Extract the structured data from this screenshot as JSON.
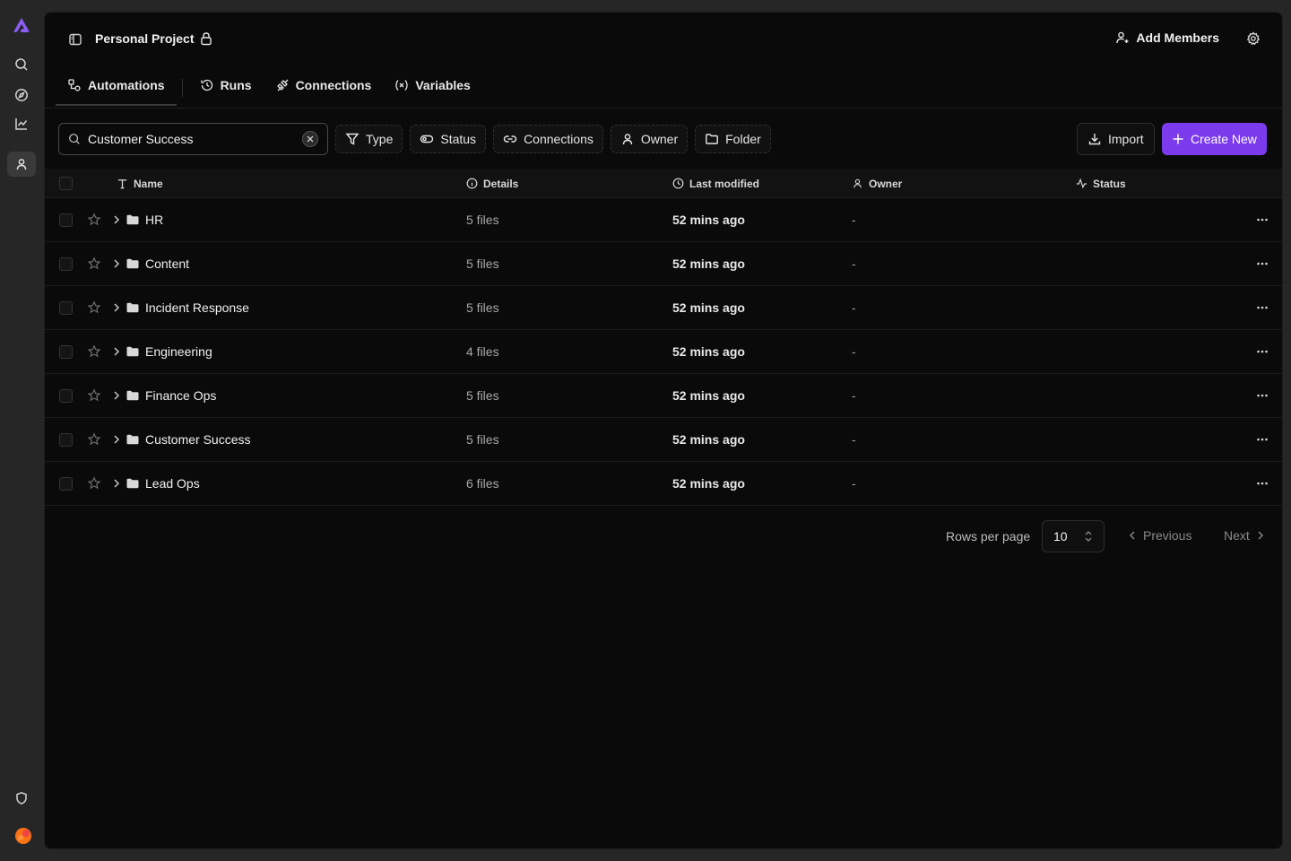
{
  "project": {
    "title": "Personal Project"
  },
  "header": {
    "add_members_label": "Add Members"
  },
  "tabs": [
    {
      "label": "Automations",
      "icon": "automations-icon",
      "active": true
    },
    {
      "label": "Runs",
      "icon": "history-icon"
    },
    {
      "label": "Connections",
      "icon": "plug-icon"
    },
    {
      "label": "Variables",
      "icon": "variable-icon"
    }
  ],
  "search": {
    "value": "Customer Success",
    "placeholder": "Search"
  },
  "filters": [
    {
      "label": "Type",
      "icon": "filter-icon"
    },
    {
      "label": "Status",
      "icon": "toggle-icon"
    },
    {
      "label": "Connections",
      "icon": "link-icon"
    },
    {
      "label": "Owner",
      "icon": "user-icon"
    },
    {
      "label": "Folder",
      "icon": "folder-icon"
    }
  ],
  "actions": {
    "import_label": "Import",
    "create_label": "Create New"
  },
  "table": {
    "columns": [
      "Name",
      "Details",
      "Last modified",
      "Owner",
      "Status"
    ],
    "rows": [
      {
        "name": "HR",
        "details": "5 files",
        "modified": "52 mins ago",
        "owner": "-"
      },
      {
        "name": "Content",
        "details": "5 files",
        "modified": "52 mins ago",
        "owner": "-"
      },
      {
        "name": "Incident Response",
        "details": "5 files",
        "modified": "52 mins ago",
        "owner": "-"
      },
      {
        "name": "Engineering",
        "details": "4 files",
        "modified": "52 mins ago",
        "owner": "-"
      },
      {
        "name": "Finance Ops",
        "details": "5 files",
        "modified": "52 mins ago",
        "owner": "-"
      },
      {
        "name": "Customer Success",
        "details": "5 files",
        "modified": "52 mins ago",
        "owner": "-"
      },
      {
        "name": "Lead Ops",
        "details": "6 files",
        "modified": "52 mins ago",
        "owner": "-"
      }
    ]
  },
  "pagination": {
    "rows_per_page_label": "Rows per page",
    "rows_per_page": "10",
    "previous_label": "Previous",
    "next_label": "Next"
  },
  "colors": {
    "accent": "#7c3aed",
    "background": "#0a0a0a",
    "rail": "#262626"
  }
}
